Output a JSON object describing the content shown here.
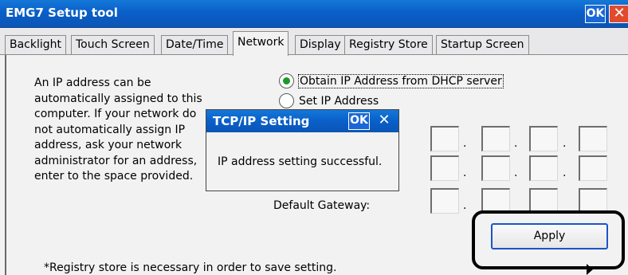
{
  "window": {
    "title": "EMG7 Setup tool",
    "ok_label": "OK",
    "close_icon": "close-icon",
    "titlebar_color": "#0a5fc8"
  },
  "tabs": [
    {
      "label": "Backlight",
      "active": false
    },
    {
      "label": "Touch Screen",
      "active": false
    },
    {
      "label": "Date/Time",
      "active": false
    },
    {
      "label": "Network",
      "active": true
    },
    {
      "label": "Display",
      "active": false
    },
    {
      "label": "Registry Store",
      "active": false
    },
    {
      "label": "Startup Screen",
      "active": false
    }
  ],
  "network": {
    "description_lines": [
      "An IP address can be",
      "automatically assigned to this",
      "computer. If your network do",
      "not automatically assign IP",
      "address, ask your network",
      "administrator for an address,",
      "enter to the space provided."
    ],
    "option_dhcp": "Obtain IP Address from DHCP server",
    "option_static": "Set IP Address",
    "selected_option": "dhcp",
    "gateway_label": "Default Gateway:",
    "apply_label": "Apply",
    "note": "*Registry store is necessary in order to save setting."
  },
  "dialog": {
    "title": "TCP/IP Setting",
    "ok_label": "OK",
    "close_icon": "close-icon",
    "message": "IP address setting successful."
  }
}
